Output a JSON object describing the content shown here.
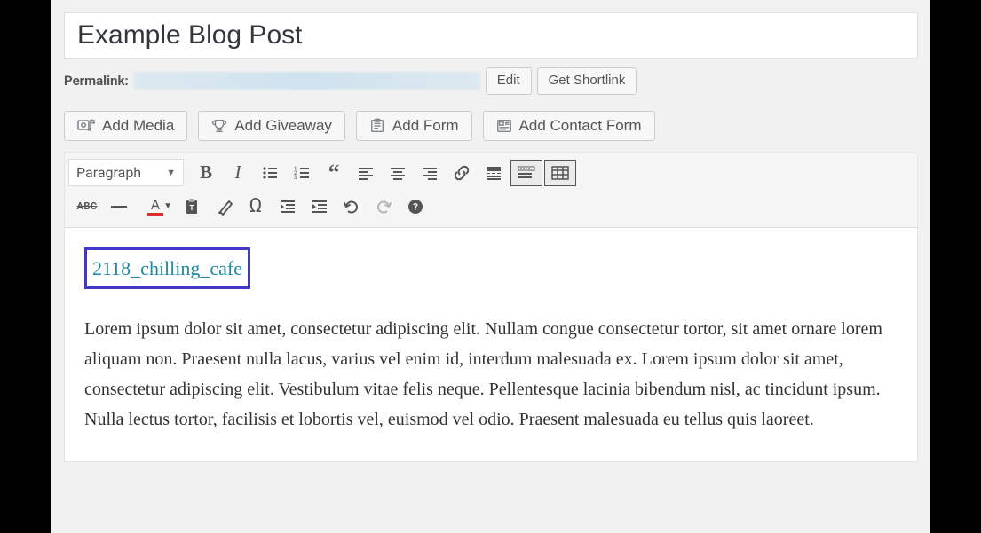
{
  "post": {
    "title": "Example Blog Post"
  },
  "permalink": {
    "label": "Permalink:",
    "edit_label": "Edit",
    "shortlink_label": "Get Shortlink"
  },
  "media_buttons": {
    "add_media": "Add Media",
    "add_giveaway": "Add Giveaway",
    "add_form": "Add Form",
    "add_contact_form": "Add Contact Form"
  },
  "toolbar": {
    "format_selected": "Paragraph",
    "abc_label": "ABC"
  },
  "content": {
    "shortcode": "2118_chilling_cafe",
    "paragraph": "Lorem ipsum dolor sit amet, consectetur adipiscing elit. Nullam congue consectetur tortor, sit amet ornare lorem aliquam non. Praesent nulla lacus, varius vel enim id, interdum malesuada ex. Lorem ipsum dolor sit amet, consectetur adipiscing elit. Vestibulum vitae felis neque. Pellentesque lacinia bibendum nisl, ac tincidunt ipsum. Nulla lectus tortor, facilisis et lobortis vel, euismod vel odio. Praesent malesuada eu tellus quis laoreet."
  }
}
